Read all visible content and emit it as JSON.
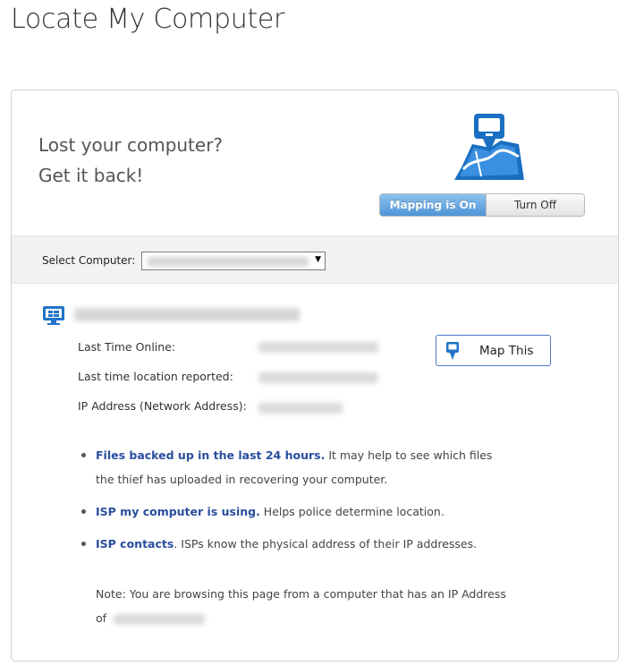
{
  "page": {
    "title": "Locate My Computer"
  },
  "hero": {
    "line1": "Lost your computer?",
    "line2": "Get it back!",
    "icon": "map-computer-icon"
  },
  "toggle": {
    "on_label": "Mapping is On",
    "off_label": "Turn Off",
    "state": "on",
    "on_color": "#5a9ee0"
  },
  "select": {
    "label": "Select Computer:",
    "arrow": "▼"
  },
  "computer": {
    "icon": "monitor-icon",
    "fields": [
      {
        "label": "Last Time Online:"
      },
      {
        "label": "Last time location reported:"
      },
      {
        "label": "IP Address (Network Address):"
      }
    ]
  },
  "map_button": {
    "label": "Map This",
    "icon": "map-pin-computer-icon",
    "border_color": "#4b7dbf"
  },
  "bullets": [
    {
      "link": "Files backed up in the last 24 hours.",
      "text": " It may help to see which files the thief has uploaded in recovering your computer."
    },
    {
      "link": "ISP my computer is using.",
      "text": " Helps police determine location."
    },
    {
      "link": "ISP contacts",
      "text": ". ISPs know the physical address of their IP addresses."
    }
  ],
  "note": {
    "text": "Note: You are browsing this page from a computer that has an IP Address of"
  },
  "colors": {
    "link": "#2a4e9e",
    "accent": "#4a8fd6"
  }
}
